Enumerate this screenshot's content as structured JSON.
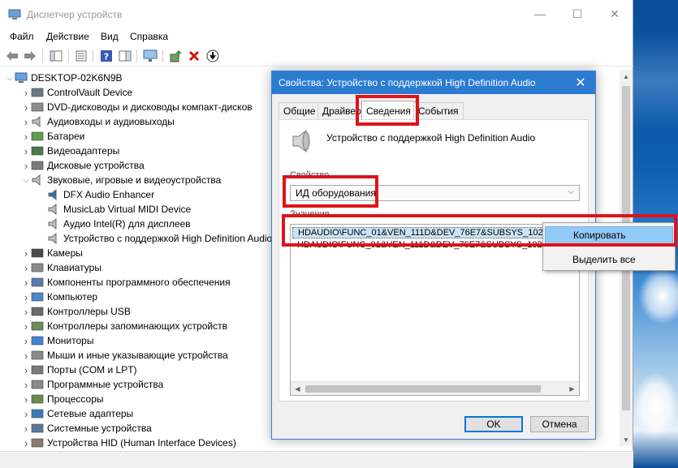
{
  "window": {
    "title": "Диспетчер устройств",
    "minimize": "—",
    "maximize": "☐",
    "close": "✕"
  },
  "menu": [
    "Файл",
    "Действие",
    "Вид",
    "Справка"
  ],
  "tree": {
    "root": "DESKTOP-02K6N9B",
    "items": [
      {
        "label": "ControlVault Device",
        "expanded": false,
        "level": 1,
        "icon": "security-device-icon"
      },
      {
        "label": "DVD-дисководы и дисководы компакт-дисков",
        "expanded": false,
        "level": 1,
        "icon": "dvd-drive-icon"
      },
      {
        "label": "Аудиовходы и аудиовыходы",
        "expanded": false,
        "level": 1,
        "icon": "speaker-icon"
      },
      {
        "label": "Батареи",
        "expanded": false,
        "level": 1,
        "icon": "battery-icon"
      },
      {
        "label": "Видеоадаптеры",
        "expanded": false,
        "level": 1,
        "icon": "display-adapter-icon"
      },
      {
        "label": "Дисковые устройства",
        "expanded": false,
        "level": 1,
        "icon": "disk-drive-icon"
      },
      {
        "label": "Звуковые, игровые и видеоустройства",
        "expanded": true,
        "level": 1,
        "icon": "speaker-icon"
      },
      {
        "label": "DFX Audio Enhancer",
        "level": 2,
        "icon": "audio-device-icon"
      },
      {
        "label": "MusicLab Virtual MIDI Device",
        "level": 2,
        "icon": "speaker-icon"
      },
      {
        "label": "Аудио Intel(R) для дисплеев",
        "level": 2,
        "icon": "speaker-icon"
      },
      {
        "label": "Устройство с поддержкой High Definition Audio",
        "level": 2,
        "icon": "speaker-icon"
      },
      {
        "label": "Камеры",
        "expanded": false,
        "level": 1,
        "icon": "camera-icon"
      },
      {
        "label": "Клавиатуры",
        "expanded": false,
        "level": 1,
        "icon": "keyboard-icon"
      },
      {
        "label": "Компоненты программного обеспечения",
        "expanded": false,
        "level": 1,
        "icon": "software-component-icon"
      },
      {
        "label": "Компьютер",
        "expanded": false,
        "level": 1,
        "icon": "computer-icon"
      },
      {
        "label": "Контроллеры USB",
        "expanded": false,
        "level": 1,
        "icon": "usb-icon"
      },
      {
        "label": "Контроллеры запоминающих устройств",
        "expanded": false,
        "level": 1,
        "icon": "storage-controller-icon"
      },
      {
        "label": "Мониторы",
        "expanded": false,
        "level": 1,
        "icon": "monitor-icon"
      },
      {
        "label": "Мыши и иные указывающие устройства",
        "expanded": false,
        "level": 1,
        "icon": "mouse-icon"
      },
      {
        "label": "Порты (COM и LPT)",
        "expanded": false,
        "level": 1,
        "icon": "port-icon"
      },
      {
        "label": "Программные устройства",
        "expanded": false,
        "level": 1,
        "icon": "software-device-icon"
      },
      {
        "label": "Процессоры",
        "expanded": false,
        "level": 1,
        "icon": "processor-icon"
      },
      {
        "label": "Сетевые адаптеры",
        "expanded": false,
        "level": 1,
        "icon": "network-adapter-icon"
      },
      {
        "label": "Системные устройства",
        "expanded": false,
        "level": 1,
        "icon": "system-device-icon"
      },
      {
        "label": "Устройства HID (Human Interface Devices)",
        "expanded": false,
        "level": 1,
        "icon": "hid-icon"
      }
    ]
  },
  "dialog": {
    "title": "Свойства: Устройство с поддержкой High Definition Audio",
    "tabs": [
      "Общие",
      "Драйвер",
      "Сведения",
      "События"
    ],
    "active_tab": "Сведения",
    "device_name": "Устройство с поддержкой High Definition Audio",
    "property_label": "Свойство",
    "property_value": "ИД оборудования",
    "value_label": "Значение",
    "values": [
      "HDAUDIO\\FUNC_01&VEN_111D&DEV_76E7&SUBSYS_10280",
      "HDAUDIO\\FUNC_01&VEN_111D&DEV_76E7&SUBSYS_10280"
    ],
    "ok": "OK",
    "cancel": "Отмена"
  },
  "context_menu": {
    "items": [
      "Копировать",
      "Выделить все"
    ],
    "highlighted": "Копировать"
  },
  "colors": {
    "dialog_title_bg": "#2b7bd1",
    "highlight_red": "#e0121b",
    "selection": "#cce4f7",
    "menu_hover": "#91c9f7"
  }
}
